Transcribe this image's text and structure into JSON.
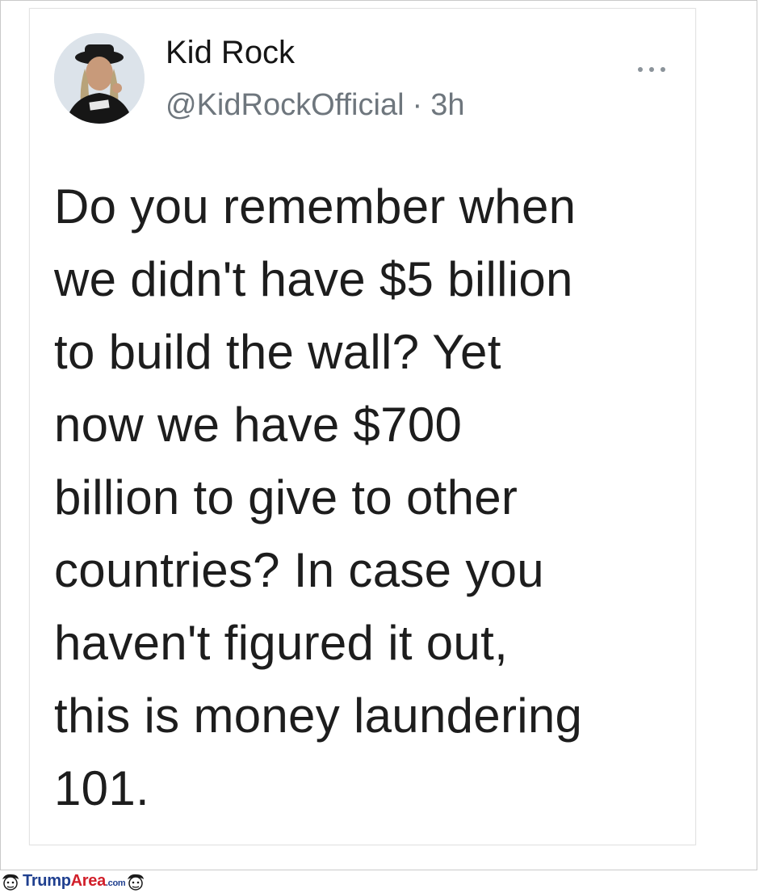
{
  "tweet": {
    "author": {
      "display_name": "Kid Rock",
      "handle": "@KidRockOfficial",
      "separator": "·",
      "time_ago": "3h"
    },
    "more_icon": "more-horizontal-icon",
    "text_lines": [
      "Do you remember when",
      "we didn't have $5 billion",
      "to build the wall? Yet",
      "now we have $700",
      "billion to give to other",
      "countries? In case you",
      "haven't figured it out,",
      "this is money laundering",
      "101."
    ]
  },
  "watermark": {
    "part1": "Trump",
    "part2": "Area",
    "suffix": ".com",
    "icon": "cartoon-face-icon"
  },
  "colors": {
    "text": "#1d1d1d",
    "meta": "#6e767d",
    "watermark_blue": "#1f3f8f",
    "watermark_red": "#d11f2a"
  }
}
